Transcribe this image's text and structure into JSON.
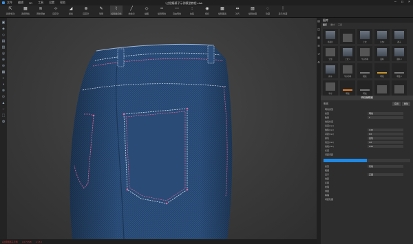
{
  "app": {
    "title": "*过把瘾裤子示例模型教程.zfab"
  },
  "menu": [
    "文件",
    "编辑",
    "3D",
    "工具",
    "设置",
    "帮助"
  ],
  "toolbar": [
    {
      "icon": "move-icon",
      "label": "选择/移动"
    },
    {
      "icon": "transform-icon",
      "label": "选择网格"
    },
    {
      "icon": "fold-icon",
      "label": "调整褶皱"
    },
    {
      "icon": "tack-icon",
      "label": "固定针"
    },
    {
      "icon": "drape-icon",
      "label": "模拟"
    },
    {
      "icon": "pin-icon",
      "label": "固定针"
    },
    {
      "icon": "brush-icon",
      "label": "笔刷"
    },
    {
      "icon": "seam-icon",
      "label": "编辑缝纫线"
    },
    {
      "icon": "line-icon",
      "label": "线缝纫"
    },
    {
      "icon": "trace-icon",
      "label": "描图"
    },
    {
      "icon": "stitch-icon",
      "label": "编辑明线"
    },
    {
      "icon": "trim-icon",
      "label": "自由明线"
    },
    {
      "icon": "zip-icon",
      "label": "拉链"
    },
    {
      "icon": "button-icon",
      "label": "纽扣"
    },
    {
      "icon": "pattern-icon",
      "label": "编辑图案"
    },
    {
      "icon": "match-icon",
      "label": "对齐"
    },
    {
      "icon": "fabric-icon",
      "label": "编辑纹理"
    },
    {
      "icon": "hide-icon",
      "label": "隐藏"
    },
    {
      "icon": "more-icon",
      "label": "显示/隐藏"
    }
  ],
  "left_tools": [
    "▣",
    "◈",
    "◇",
    "▤",
    "▥",
    "◎",
    "⊕",
    "⊖",
    "▦",
    "◐",
    "◑",
    "⊗",
    "⊙",
    "▲",
    "◌",
    "⬚",
    "◍"
  ],
  "library": {
    "title": "图库",
    "tabs": [
      "图库",
      "素材",
      "工具"
    ],
    "items": [
      {
        "type": "shirt",
        "cap": "裤前片"
      },
      {
        "type": "fab",
        "cap": ""
      },
      {
        "type": "shirt",
        "cap": "上衣"
      },
      {
        "type": "shirt",
        "cap": "上衣2"
      },
      {
        "type": "shirt",
        "cap": "裙子"
      },
      {
        "type": "fab",
        "cap": "全部"
      },
      {
        "type": "shirt",
        "cap": "上衣 1"
      },
      {
        "type": "fab",
        "cap": "牛仔布料"
      },
      {
        "type": "shirt",
        "cap": "面料"
      },
      {
        "type": "shirt",
        "cap": "面料 2"
      },
      {
        "type": "shirt",
        "cap": "裤子"
      },
      {
        "type": "fab",
        "cap": "牛仔布料"
      },
      {
        "type": "dark",
        "cap": "图案"
      },
      {
        "type": "gold",
        "cap": "明线"
      },
      {
        "type": "dark",
        "cap": "明线 2"
      },
      {
        "type": "fab",
        "cap": "牛仔"
      },
      {
        "type": "orange",
        "cap": "明线"
      },
      {
        "type": "dark",
        "cap": "明线"
      },
      {
        "type": "fab",
        "cap": ""
      },
      {
        "type": "fab",
        "cap": ""
      }
    ]
  },
  "props": {
    "header": "明线编辑器",
    "title": "明线",
    "btn_a": "应用",
    "btn_b": "删除",
    "rows": [
      {
        "k": "明线类型",
        "v": ""
      },
      {
        "k": "类型",
        "v": "明线"
      },
      {
        "k": "数量",
        "v": "1"
      },
      {
        "k": "线段长度",
        "v": ""
      },
      {
        "k": "宽度(mm)",
        "v": ""
      },
      {
        "k": "偏移(mm)",
        "v": "1.00"
      },
      {
        "k": "间距(mm)",
        "v": "0.0"
      },
      {
        "k": "颜色",
        "v": "金色"
      },
      {
        "k": "线宽(mm)",
        "v": "4.0"
      },
      {
        "k": "线段(mm)",
        "v": "2.00"
      },
      {
        "k": "长度",
        "v": ""
      },
      {
        "k": "间距间距",
        "v": ""
      }
    ],
    "rows2": [
      {
        "k": "类型",
        "v": "实线"
      },
      {
        "k": "粗细",
        "v": ""
      },
      {
        "k": "显示",
        "v": "正面"
      },
      {
        "k": "线距",
        "v": ""
      },
      {
        "k": "反面",
        "v": ""
      },
      {
        "k": "纹理",
        "v": ""
      },
      {
        "k": "绣图",
        "v": ""
      },
      {
        "k": "精确",
        "v": ""
      },
      {
        "k": "间距隐藏",
        "v": ""
      }
    ]
  },
  "status": [
    "●过把瘾裤子示例",
    "A 0.73 MB",
    "● 1.6.3"
  ],
  "colors": {
    "accent": "#1e88e5",
    "denim": "#2a4c78",
    "stitch": "#e05a8a"
  }
}
